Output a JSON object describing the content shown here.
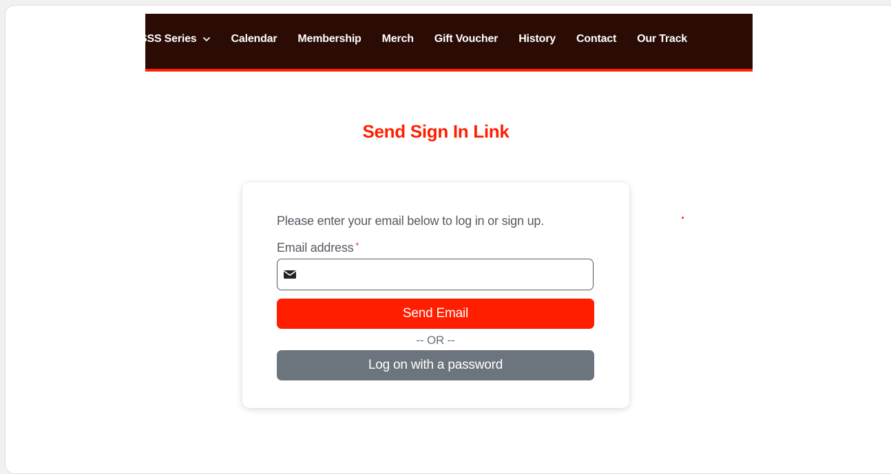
{
  "nav": {
    "items": [
      {
        "label": "SSS Series",
        "has_dropdown": true
      },
      {
        "label": "Calendar"
      },
      {
        "label": "Membership"
      },
      {
        "label": "Merch"
      },
      {
        "label": "Gift Voucher"
      },
      {
        "label": "History"
      },
      {
        "label": "Contact"
      },
      {
        "label": "Our Track"
      }
    ]
  },
  "page": {
    "title": "Send Sign In Link"
  },
  "form": {
    "instruction": "Please enter your email below to log in or sign up.",
    "email_label": "Email address",
    "required_mark": "*",
    "email_value": "",
    "email_icon": "envelope-icon",
    "send_button_label": "Send Email",
    "separator": "-- OR --",
    "password_button_label": "Log on with a password"
  },
  "colors": {
    "brand_red": "#ff1e00",
    "nav_background": "#2a0c05",
    "secondary_button": "#6c757d",
    "text_muted": "#555a61"
  }
}
